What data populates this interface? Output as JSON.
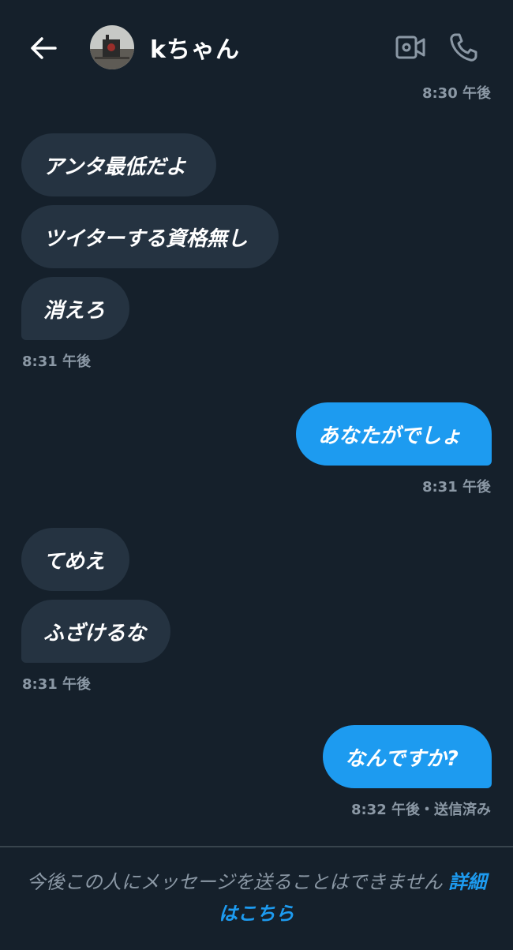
{
  "header": {
    "contact_name": "kちゃん",
    "back_icon": "arrow-left-icon",
    "video_icon": "video-camera-icon",
    "call_icon": "phone-icon"
  },
  "messages": {
    "ts_top": "8:30 午後",
    "in1": {
      "m1": "アンタ最低だよ",
      "m2": "ツイターする資格無し",
      "m3": "消えろ",
      "time": "8:31 午後"
    },
    "out1": {
      "text": "あなたがでしょ",
      "time": "8:31 午後"
    },
    "in2": {
      "m1": "てめえ",
      "m2": "ふざけるな",
      "time": "8:31 午後"
    },
    "out2": {
      "text": "なんですか?",
      "time": "8:32 午後・送信済み"
    }
  },
  "footer": {
    "notice": "今後この人にメッセージを送ることはできません",
    "link": "詳細はこちら"
  },
  "colors": {
    "background": "#15202b",
    "incoming_bubble": "#253341",
    "outgoing_bubble": "#1d9bf0",
    "muted_text": "#8b98a5"
  }
}
